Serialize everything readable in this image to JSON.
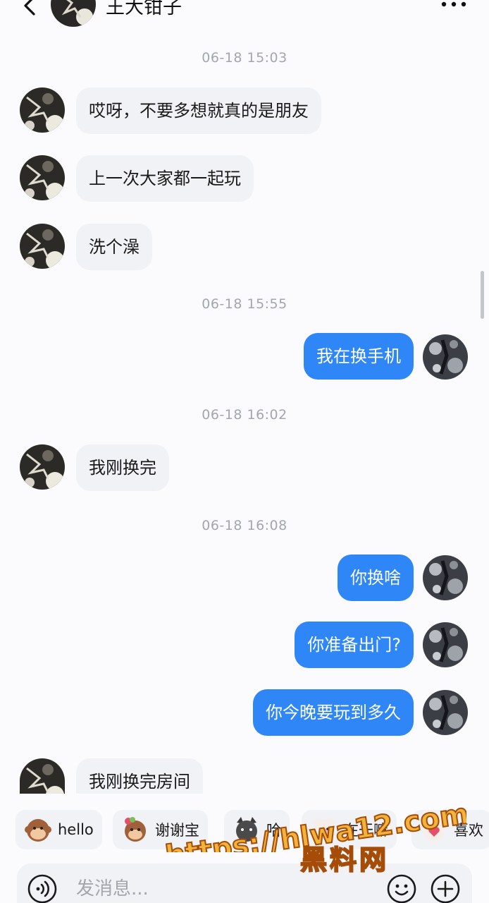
{
  "header": {
    "title": "王大钳子",
    "back_icon": "chevron-left-icon",
    "more_icon": "more-dots-icon"
  },
  "messages": [
    {
      "kind": "time",
      "text": "06-18 15:03"
    },
    {
      "kind": "msg",
      "side": "left",
      "text": "哎呀，不要多想就真的是朋友"
    },
    {
      "kind": "msg",
      "side": "left",
      "text": "上一次大家都一起玩"
    },
    {
      "kind": "msg",
      "side": "left",
      "text": "洗个澡"
    },
    {
      "kind": "time",
      "text": "06-18 15:55"
    },
    {
      "kind": "msg",
      "side": "right",
      "text": "我在换手机"
    },
    {
      "kind": "time",
      "text": "06-18 16:02"
    },
    {
      "kind": "msg",
      "side": "left",
      "text": "我刚换完"
    },
    {
      "kind": "time",
      "text": "06-18 16:08"
    },
    {
      "kind": "msg",
      "side": "right",
      "text": "你换啥"
    },
    {
      "kind": "msg",
      "side": "right",
      "text": "你准备出门?"
    },
    {
      "kind": "msg",
      "side": "right",
      "text": "你今晚要玩到多久"
    },
    {
      "kind": "msg",
      "side": "left",
      "text": "我刚换完房间"
    }
  ],
  "quick_replies": [
    {
      "label": "hello",
      "emoji": "monkey-emoji"
    },
    {
      "label": "谢谢宝",
      "emoji": "monkey-flower-emoji"
    },
    {
      "label": "哈",
      "emoji": "cat-emoji"
    },
    {
      "label": "在干嘛",
      "emoji": "sheep-emoji"
    },
    {
      "label": "喜欢",
      "emoji": "sheep-heart-emoji"
    }
  ],
  "composer": {
    "placeholder": "发消息...",
    "voice_icon": "voice-icon",
    "emoji_icon": "emoji-icon",
    "plus_icon": "plus-icon"
  },
  "watermark": {
    "url": "https://hlwa12.com",
    "site_name": "黑料网"
  },
  "colors": {
    "accent_blue": "#2f86f6",
    "bubble_gray": "#f1f2f5",
    "timestamp_gray": "#a3a6ad",
    "watermark_yellow": "#f2b33d"
  }
}
